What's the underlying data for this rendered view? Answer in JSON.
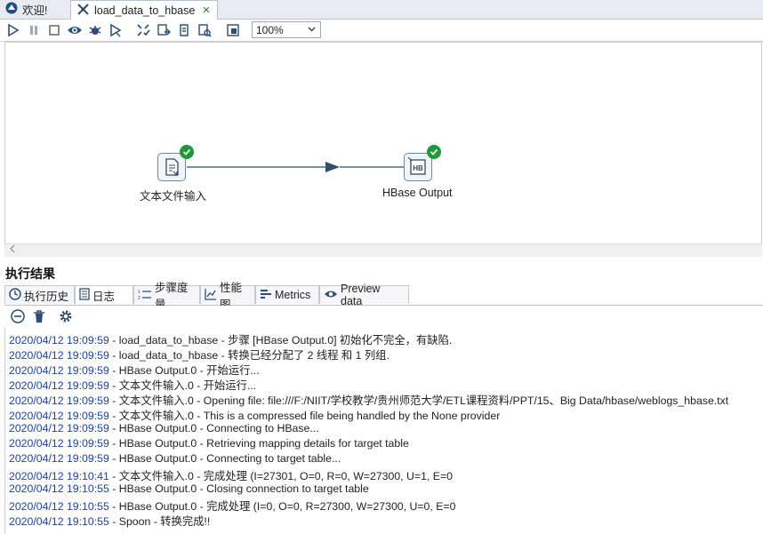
{
  "editor_tabs": [
    {
      "label": "欢迎!"
    },
    {
      "label": "load_data_to_hbase",
      "close": "✕"
    }
  ],
  "toolbar": {
    "zoom": "100%"
  },
  "canvas": {
    "nodes": [
      {
        "label": "文本文件输入"
      },
      {
        "label": "HBase Output"
      }
    ]
  },
  "results": {
    "title": "执行结果",
    "tabs": [
      {
        "label": "执行历史"
      },
      {
        "label": "日志"
      },
      {
        "label": "步骤度量"
      },
      {
        "label": "性能图"
      },
      {
        "label": "Metrics"
      },
      {
        "label": "Preview data"
      }
    ]
  },
  "log_lines": [
    {
      "ts": "2020/04/12 19:09:59",
      "msg": " - load_data_to_hbase - 步骤 [HBase Output.0] 初始化不完全，有缺陷."
    },
    {
      "ts": "2020/04/12 19:09:59",
      "msg": " - load_data_to_hbase - 转换已经分配了 2 线程 和 1 列组."
    },
    {
      "ts": "2020/04/12 19:09:59",
      "msg": " - HBase Output.0 - 开始运行..."
    },
    {
      "ts": "2020/04/12 19:09:59",
      "msg": " - 文本文件输入.0 - 开始运行..."
    },
    {
      "ts": "2020/04/12 19:09:59",
      "msg": " - 文本文件输入.0 - Opening file: file:///F:/NIIT/学校教学/贵州师范大学/ETL课程资料/PPT/15、Big Data/hbase/weblogs_hbase.txt"
    },
    {
      "ts": "2020/04/12 19:09:59",
      "msg": " - 文本文件输入.0 - This is a compressed file being handled by the None provider"
    },
    {
      "ts": "2020/04/12 19:09:59",
      "msg": " - HBase Output.0 - Connecting to HBase..."
    },
    {
      "ts": "2020/04/12 19:09:59",
      "msg": " - HBase Output.0 - Retrieving mapping details for target table"
    },
    {
      "ts": "2020/04/12 19:09:59",
      "msg": " - HBase Output.0 - Connecting to target table..."
    },
    {
      "ts": "2020/04/12 19:10:41",
      "msg": " - 文本文件输入.0 - 完成处理 (I=27301, O=0, R=0, W=27300, U=1, E=0"
    },
    {
      "ts": "2020/04/12 19:10:55",
      "msg": " - HBase Output.0 - Closing connection to target table"
    },
    {
      "ts": "2020/04/12 19:10:55",
      "msg": " - HBase Output.0 - 完成处理 (I=0, O=0, R=27300, W=27300, U=0, E=0"
    },
    {
      "ts": "2020/04/12 19:10:55",
      "msg": " - Spoon - 转换完成!!"
    }
  ]
}
